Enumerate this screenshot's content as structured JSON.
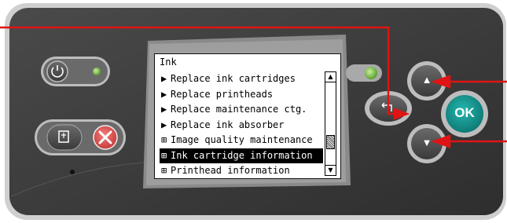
{
  "screen": {
    "title": "Ink",
    "menu_items": [
      {
        "mark": "▶",
        "label": "Replace ink cartridges",
        "selected": false
      },
      {
        "mark": "▶",
        "label": "Replace printheads",
        "selected": false
      },
      {
        "mark": "▶",
        "label": "Replace maintenance ctg.",
        "selected": false
      },
      {
        "mark": "▶",
        "label": "Replace ink absorber",
        "selected": false
      },
      {
        "mark": "⊞",
        "label": "Image quality maintenance",
        "selected": false
      },
      {
        "mark": "⊞",
        "label": "Ink cartridge information",
        "selected": true
      },
      {
        "mark": "⊞",
        "label": "Printhead information",
        "selected": false
      }
    ],
    "scroll_up_glyph": "▲",
    "scroll_down_glyph": "▼"
  },
  "buttons": {
    "ok_label": "OK",
    "up_glyph": "▲",
    "down_glyph": "▼"
  },
  "colors": {
    "panel": "#3c3c3c",
    "panel_border": "#bdbdbd",
    "ok_button": "#169a94",
    "cancel_button": "#e2504f",
    "led": "#7dc04a",
    "callout_line": "#e01414"
  }
}
